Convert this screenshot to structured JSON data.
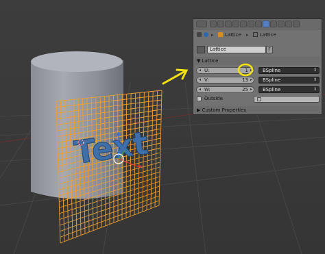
{
  "viewport": {
    "overlay_text": "Text",
    "lattice_color": "#f0a030",
    "text_color": "#3e6fa8",
    "annotation_color": "#f2e010"
  },
  "panel": {
    "toolbar": {
      "tools": [
        "render-icon",
        "render-layers-icon",
        "scene-icon",
        "world-icon",
        "object-icon",
        "constraints-icon",
        "modifiers-icon",
        "data-icon",
        "material-icon",
        "texture-icon",
        "particles-icon",
        "physics-icon"
      ]
    },
    "breadcrumb": {
      "object": "Lattice",
      "data": "Lattice"
    },
    "datablock": {
      "name": "Lattice",
      "fake_user": "F"
    },
    "section": {
      "title": "Lattice",
      "custom_properties": "Custom Properties"
    },
    "fields": {
      "u": {
        "label": "U:",
        "value": "1",
        "interp": "BSpline"
      },
      "v": {
        "label": "V:",
        "value": "13",
        "interp": "BSpline"
      },
      "w": {
        "label": "W:",
        "value": "25",
        "interp": "BSpline"
      },
      "outside": "Outside"
    }
  }
}
